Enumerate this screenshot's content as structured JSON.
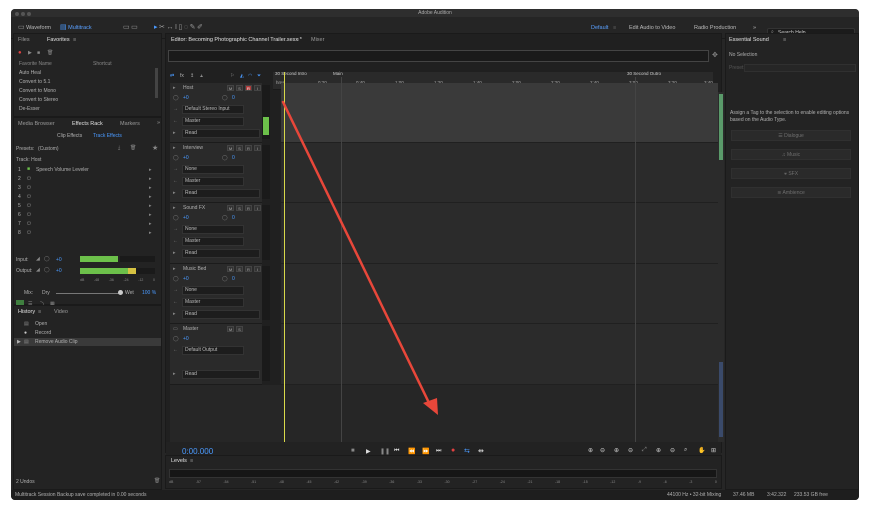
{
  "window": {
    "title": "Adobe Audition"
  },
  "toolbar": {
    "waveform": "Waveform",
    "multitrack": "Multitrack",
    "workspaces": [
      "Default",
      "Edit Audio to Video",
      "Radio Production"
    ],
    "more": "»",
    "search_placeholder": "Search Help"
  },
  "files_panel": {
    "tabs": [
      "Files",
      "Favorites"
    ],
    "columns": [
      "Favorite Name",
      "Shortcut"
    ],
    "items": [
      "Auto Heal",
      "Convert to 5.1",
      "Convert to Mono",
      "Convert to Stereo",
      "De-Esser"
    ]
  },
  "effects_panel": {
    "tabs": [
      "Media Browser",
      "Effects Rack",
      "Markers"
    ],
    "subtabs": [
      "Clip Effects",
      "Track Effects"
    ],
    "presets_label": "Presets:",
    "presets_value": "(Custom)",
    "track_label": "Track: Host",
    "slots": [
      {
        "num": "1",
        "name": "Speech Volume Leveler"
      },
      {
        "num": "2",
        "name": ""
      },
      {
        "num": "3",
        "name": ""
      },
      {
        "num": "4",
        "name": ""
      },
      {
        "num": "5",
        "name": ""
      },
      {
        "num": "6",
        "name": ""
      },
      {
        "num": "7",
        "name": ""
      },
      {
        "num": "8",
        "name": ""
      }
    ],
    "input_label": "Input:",
    "output_label": "Output:",
    "input_val": "+0",
    "output_val": "+0",
    "meter_scale": [
      "dB",
      "-48",
      "-36",
      "-24",
      "-12",
      "0"
    ],
    "mix_label": "Mix:",
    "dry_label": "Dry",
    "wet_label": "Wet",
    "mix_value": "100 %"
  },
  "history_panel": {
    "tabs": [
      "History",
      "Video"
    ],
    "items": [
      "Open",
      "Record",
      "Remove Audio Clip"
    ],
    "undos": "2 Undos"
  },
  "editor": {
    "tab_label": "Editor: Becoming Photographic Channel Trailer.sesx *",
    "mixer_tab": "Mixer",
    "ruler": [
      "hms",
      "0:20",
      "0:40",
      "1:00",
      "1:20",
      "1:40",
      "2:00",
      "2:20",
      "2:40",
      "3:00",
      "3:20",
      "3:40"
    ],
    "markers": [
      "30 Second Intro",
      "Main",
      "30 Second Outro"
    ],
    "time_display": "0:00.000",
    "tracks": [
      {
        "name": "Host",
        "vol": "+0",
        "pan": "0",
        "input": "Default Stereo Input",
        "output": "Master",
        "mode": "Read",
        "color": "#3f8f5f"
      },
      {
        "name": "Interview",
        "vol": "+0",
        "pan": "0",
        "input": "None",
        "output": "Master",
        "mode": "Read",
        "color": "#3a6a8f"
      },
      {
        "name": "Sound FX",
        "vol": "+0",
        "pan": "0",
        "input": "None",
        "output": "Master",
        "mode": "Read",
        "color": "#4f5f2f"
      },
      {
        "name": "Music Bed",
        "vol": "+0",
        "pan": "0",
        "input": "None",
        "output": "Master",
        "mode": "Read",
        "color": "#6f2f2f"
      },
      {
        "name": "Master",
        "vol": "+0",
        "pan": "",
        "input": "",
        "output": "Default Output",
        "mode": "Read",
        "color": "#2f3f6f"
      }
    ]
  },
  "levels_panel": {
    "title": "Levels",
    "scale": [
      "dB",
      "-57",
      "-54",
      "-51",
      "-48",
      "-45",
      "-42",
      "-39",
      "-36",
      "-33",
      "-30",
      "-27",
      "-24",
      "-21",
      "-18",
      "-15",
      "-12",
      "-9",
      "-6",
      "-3",
      "0"
    ]
  },
  "essential_sound": {
    "title": "Essential Sound",
    "no_selection": "No Selection",
    "presets_label": "Preset:",
    "hint": "Assign a Tag to the selection to enable editing options based on the Audio Type.",
    "types": [
      "Dialogue",
      "Music",
      "SFX",
      "Ambience"
    ]
  },
  "status": {
    "message": "Multitrack Session Backup save completed in 0.00 seconds",
    "sample": "44100 Hz • 32-bit Mixing",
    "size": "37.46 MB",
    "duration": "3:42.322",
    "free": "233.53 GB free"
  },
  "colors": {
    "accent": "#4a9aff",
    "playhead": "#d9d94a",
    "arrow": "#e8473a"
  }
}
